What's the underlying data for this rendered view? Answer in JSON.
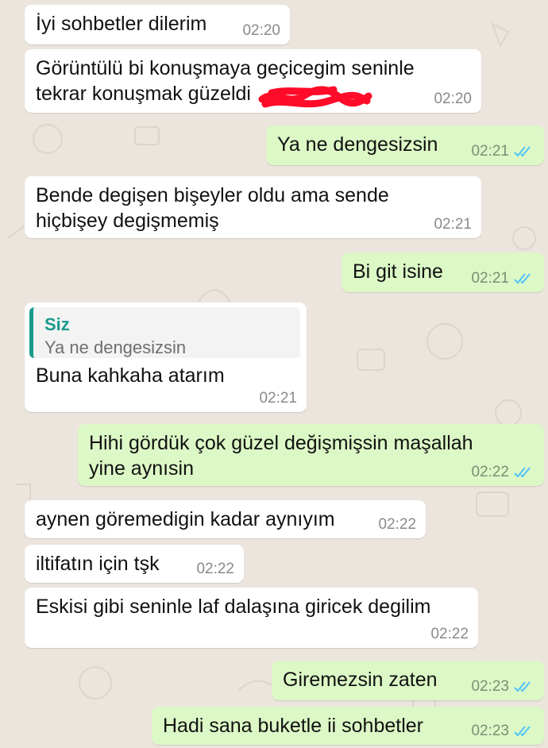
{
  "colors": {
    "background": "#ece5dd",
    "incoming_bubble": "#ffffff",
    "outgoing_bubble": "#dcf8c6",
    "read_ticks": "#4fc3f7",
    "quote_accent": "#1a9b8d",
    "redaction": "#ff0b2a"
  },
  "messages": [
    {
      "direction": "in",
      "text": "İyi sohbetler dilerim",
      "time": "02:20"
    },
    {
      "direction": "in",
      "text": "Görüntülü bi konuşmaya geçicegim seninle\ntekrar konuşmak güzeldi",
      "time": "02:20",
      "redacted": true
    },
    {
      "direction": "out",
      "text": "Ya ne dengesizsin",
      "time": "02:21",
      "status": "read"
    },
    {
      "direction": "in",
      "text": "Bende degişen bişeyler oldu ama sende\nhiçbişey degişmemiş",
      "time": "02:21"
    },
    {
      "direction": "out",
      "text": "Bi git isine",
      "time": "02:21",
      "status": "read"
    },
    {
      "direction": "in",
      "text": "Buna kahkaha atarım",
      "time": "02:21",
      "quote": {
        "author": "Siz",
        "text": "Ya ne dengesizsin"
      }
    },
    {
      "direction": "out",
      "text": "Hihi gördük çok güzel değişmişsin maşallah\nyine aynısin",
      "time": "02:22",
      "status": "read"
    },
    {
      "direction": "in",
      "text": "aynen göremedigin kadar aynıyım",
      "time": "02:22"
    },
    {
      "direction": "in",
      "text": "iltifatın için tşk",
      "time": "02:22"
    },
    {
      "direction": "in",
      "text": "Eskisi gibi seninle laf dalaşına giricek degilim",
      "time": "02:22"
    },
    {
      "direction": "out",
      "text": "Giremezsin zaten",
      "time": "02:23",
      "status": "read"
    },
    {
      "direction": "out",
      "text": "Hadi sana buketle ii sohbetler",
      "time": "02:23",
      "status": "read"
    }
  ]
}
